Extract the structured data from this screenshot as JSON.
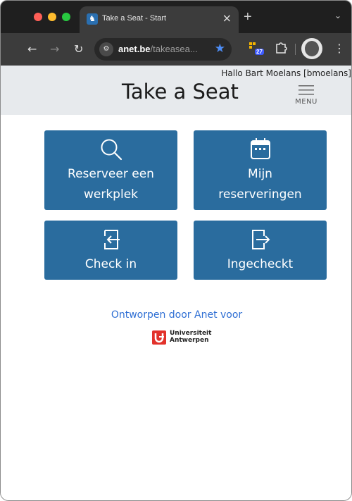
{
  "browser": {
    "tab_title": "Take a Seat - Start",
    "tab_close": "×",
    "new_tab": "+",
    "tab_menu": "⌄",
    "url_domain": "anet.be",
    "url_path": "/takeasea...",
    "extension_badge": "27"
  },
  "header": {
    "greeting": "Hallo Bart Moelans [bmoelans]",
    "title": "Take a Seat",
    "menu_label": "MENU"
  },
  "tiles": [
    {
      "line1": "Reserveer een",
      "line2": "werkplek",
      "icon": "search-icon"
    },
    {
      "line1": "Mijn",
      "line2": "reserveringen",
      "icon": "calendar-icon"
    },
    {
      "line1": "Check in",
      "icon": "check-in-icon"
    },
    {
      "line1": "Ingecheckt",
      "icon": "check-out-icon"
    }
  ],
  "footer": {
    "designed_by": "Ontworpen door Anet voor",
    "university_line1": "Universiteit",
    "university_line2": "Antwerpen"
  },
  "colors": {
    "tile": "#2a6c9e",
    "header_bg": "#e7eaed",
    "link": "#2f6fd4",
    "brand_red": "#e2322b"
  }
}
